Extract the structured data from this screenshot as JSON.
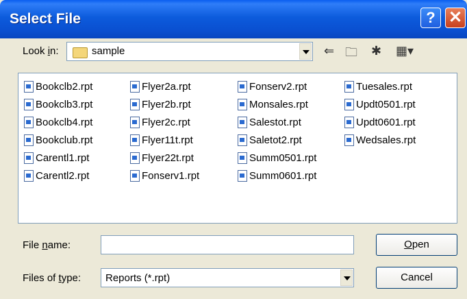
{
  "dialog": {
    "title": "Select File"
  },
  "lookin": {
    "label_pre": "Look ",
    "label_accel": "i",
    "label_post": "n:",
    "value": "sample"
  },
  "toolbar": {
    "back_icon": "back-arrow-icon",
    "up_icon": "up-folder-icon",
    "new_icon": "new-folder-icon",
    "view_icon": "view-menu-icon"
  },
  "files": [
    [
      "Bookclb2.rpt",
      "Bookclb3.rpt",
      "Bookclb4.rpt",
      "Bookclub.rpt",
      "Carentl1.rpt",
      "Carentl2.rpt"
    ],
    [
      "Flyer2a.rpt",
      "Flyer2b.rpt",
      "Flyer2c.rpt",
      "Flyer11t.rpt",
      "Flyer22t.rpt",
      "Fonserv1.rpt"
    ],
    [
      "Fonserv2.rpt",
      "Monsales.rpt",
      "Salestot.rpt",
      "Saletot2.rpt",
      "Summ0501.rpt",
      "Summ0601.rpt"
    ],
    [
      "Tuesales.rpt",
      "Updt0501.rpt",
      "Updt0601.rpt",
      "Wedsales.rpt"
    ]
  ],
  "filename": {
    "label_pre": "File ",
    "label_accel": "n",
    "label_post": "ame:",
    "value": ""
  },
  "filetype": {
    "label_pre": "Files of ",
    "label_accel": "t",
    "label_post": "ype:",
    "value": "Reports (*.rpt)"
  },
  "buttons": {
    "open_accel": "O",
    "open_rest": "pen",
    "cancel": "Cancel"
  }
}
